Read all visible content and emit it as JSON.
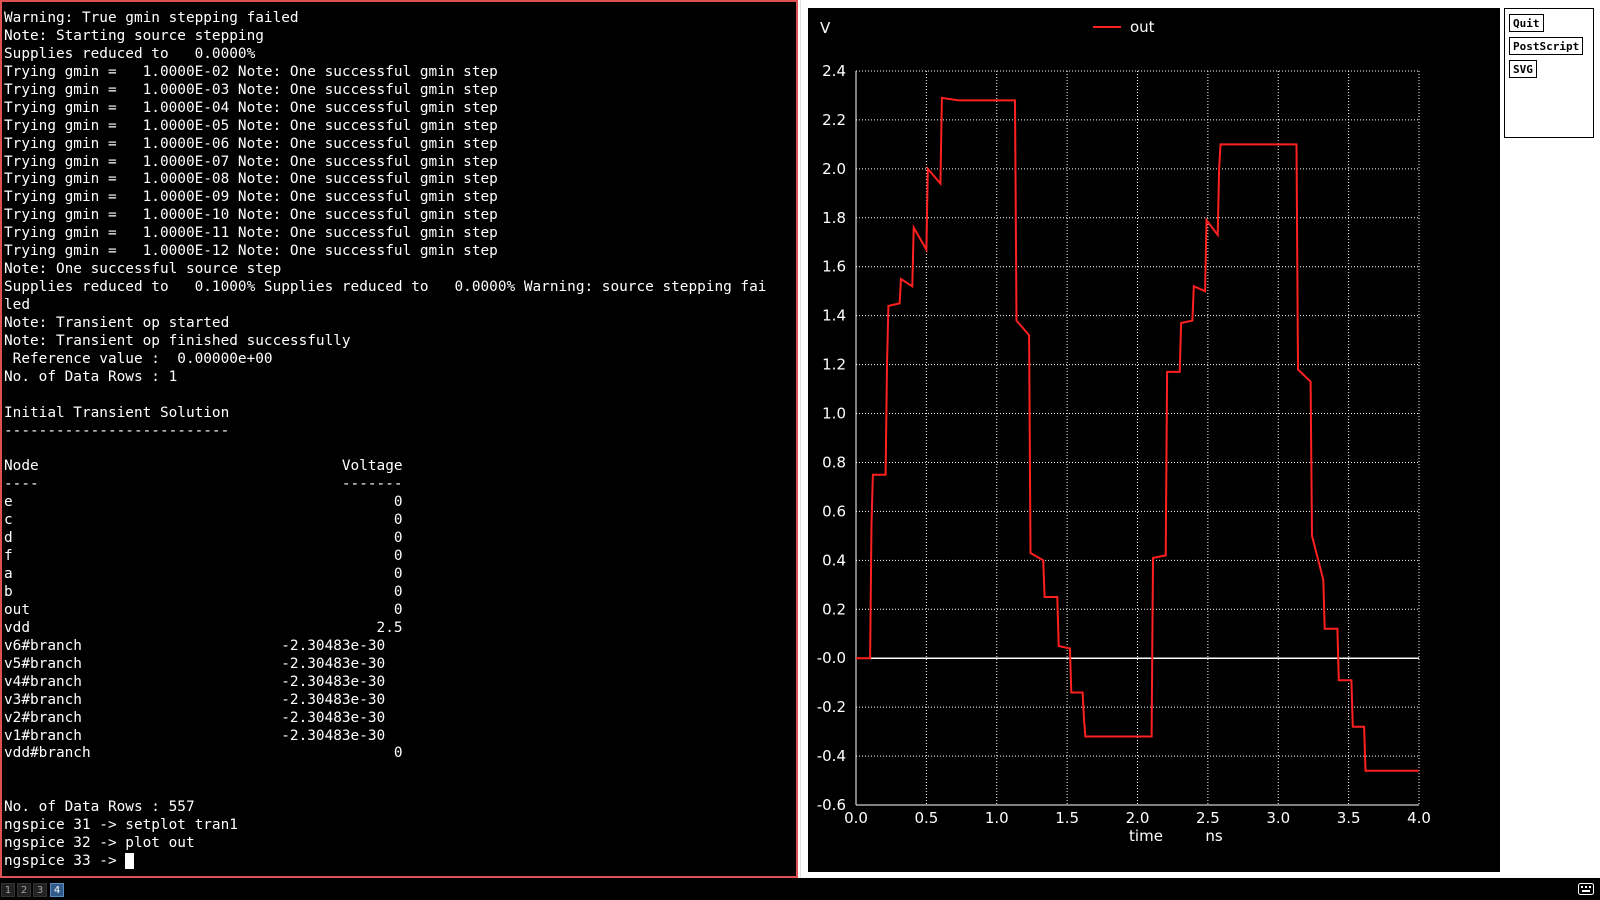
{
  "terminal": {
    "lines": [
      "Warning: True gmin stepping failed",
      "Note: Starting source stepping",
      "Supplies reduced to   0.0000%",
      "Trying gmin =   1.0000E-02 Note: One successful gmin step",
      "Trying gmin =   1.0000E-03 Note: One successful gmin step",
      "Trying gmin =   1.0000E-04 Note: One successful gmin step",
      "Trying gmin =   1.0000E-05 Note: One successful gmin step",
      "Trying gmin =   1.0000E-06 Note: One successful gmin step",
      "Trying gmin =   1.0000E-07 Note: One successful gmin step",
      "Trying gmin =   1.0000E-08 Note: One successful gmin step",
      "Trying gmin =   1.0000E-09 Note: One successful gmin step",
      "Trying gmin =   1.0000E-10 Note: One successful gmin step",
      "Trying gmin =   1.0000E-11 Note: One successful gmin step",
      "Trying gmin =   1.0000E-12 Note: One successful gmin step",
      "Note: One successful source step",
      "Supplies reduced to   0.1000% Supplies reduced to   0.0000% Warning: source stepping fai",
      "led",
      "Note: Transient op started",
      "Note: Transient op finished successfully",
      " Reference value :  0.00000e+00",
      "No. of Data Rows : 1",
      "",
      "Initial Transient Solution",
      "--------------------------",
      "",
      "Node                                   Voltage",
      "----                                   -------",
      "e                                            0",
      "c                                            0",
      "d                                            0",
      "f                                            0",
      "a                                            0",
      "b                                            0",
      "out                                          0",
      "vdd                                        2.5",
      "v6#branch                       -2.30483e-30",
      "v5#branch                       -2.30483e-30",
      "v4#branch                       -2.30483e-30",
      "v3#branch                       -2.30483e-30",
      "v2#branch                       -2.30483e-30",
      "v1#branch                       -2.30483e-30",
      "vdd#branch                                   0",
      "",
      "",
      "No. of Data Rows : 557",
      "ngspice 31 -> setplot tran1",
      "ngspice 32 -> plot out",
      "ngspice 33 -> "
    ]
  },
  "plot_window": {
    "buttons": {
      "quit": "Quit",
      "postscript": "PostScript",
      "svg": "SVG"
    }
  },
  "taskbar": {
    "workspaces": [
      "1",
      "2",
      "3",
      "4"
    ],
    "active_workspace": "4"
  },
  "colors": {
    "trace": "#ff2020",
    "grid": "#ffffff",
    "axis_text": "#ffffff",
    "plot_bg": "#000000",
    "terminal_border": "#e05252"
  },
  "chart_data": {
    "type": "line",
    "ylabel": "V",
    "xlabel": "time",
    "xunit": "ns",
    "legend": "top-center",
    "grid": true,
    "xlim": [
      0.0,
      4.0
    ],
    "ylim": [
      -0.6,
      2.4
    ],
    "xticks": [
      "0.0",
      "0.5",
      "1.0",
      "1.5",
      "2.0",
      "2.5",
      "3.0",
      "3.5",
      "4.0"
    ],
    "yticks": [
      "-0.6",
      "-0.4",
      "-0.2",
      "-0.0",
      "0.2",
      "0.4",
      "0.6",
      "0.8",
      "1.0",
      "1.2",
      "1.4",
      "1.6",
      "1.8",
      "2.0",
      "2.2",
      "2.4"
    ],
    "zero_line": 0.0,
    "series": [
      {
        "name": "out",
        "x": [
          0.0,
          0.1,
          0.11,
          0.12,
          0.21,
          0.22,
          0.23,
          0.31,
          0.32,
          0.4,
          0.41,
          0.5,
          0.51,
          0.6,
          0.61,
          0.73,
          1.13,
          1.14,
          1.23,
          1.24,
          1.33,
          1.34,
          1.43,
          1.44,
          1.52,
          1.53,
          1.61,
          1.62,
          1.63,
          2.1,
          2.11,
          2.2,
          2.21,
          2.3,
          2.31,
          2.39,
          2.4,
          2.48,
          2.49,
          2.57,
          2.58,
          2.59,
          3.13,
          3.14,
          3.23,
          3.24,
          3.32,
          3.33,
          3.42,
          3.43,
          3.52,
          3.53,
          3.61,
          3.62,
          4.0
        ],
        "y": [
          0.0,
          0.0,
          0.55,
          0.75,
          0.75,
          1.2,
          1.44,
          1.45,
          1.55,
          1.52,
          1.76,
          1.67,
          2.0,
          1.94,
          2.29,
          2.28,
          2.28,
          1.38,
          1.32,
          0.43,
          0.4,
          0.25,
          0.25,
          0.05,
          0.04,
          -0.14,
          -0.14,
          -0.25,
          -0.32,
          -0.32,
          0.41,
          0.42,
          1.17,
          1.17,
          1.37,
          1.38,
          1.52,
          1.5,
          1.79,
          1.73,
          2.0,
          2.1,
          2.1,
          1.18,
          1.13,
          0.5,
          0.32,
          0.12,
          0.12,
          -0.09,
          -0.09,
          -0.28,
          -0.28,
          -0.46,
          -0.46
        ]
      }
    ]
  }
}
